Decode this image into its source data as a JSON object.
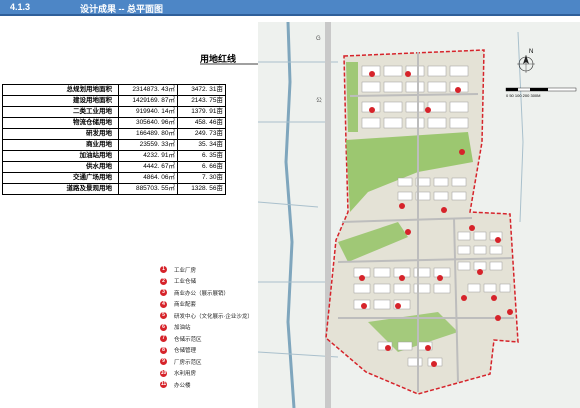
{
  "header": {
    "section": "4.1.3",
    "title": "设计成果 -- 总平面图"
  },
  "callout": "用地红线",
  "stats_table": [
    {
      "label": "总规划用地面积",
      "area": "2314873. 43㎡",
      "mu": "3472. 31亩"
    },
    {
      "label": "建设用地面积",
      "area": "1429169. 87㎡",
      "mu": "2143. 75亩"
    },
    {
      "label": "二类工业用地",
      "area": "919940. 14㎡",
      "mu": "1379. 91亩"
    },
    {
      "label": "物流仓储用地",
      "area": "305640. 96㎡",
      "mu": "458. 46亩"
    },
    {
      "label": "研发用地",
      "area": "166489. 80㎡",
      "mu": "249. 73亩"
    },
    {
      "label": "商业用地",
      "area": "23559. 33㎡",
      "mu": "35. 34亩"
    },
    {
      "label": "加油站用地",
      "area": "4232. 91㎡",
      "mu": "6. 35亩"
    },
    {
      "label": "供水用地",
      "area": "4442. 67㎡",
      "mu": "6. 66亩"
    },
    {
      "label": "交通广场用地",
      "area": "4864. 06㎡",
      "mu": "7. 30亩"
    },
    {
      "label": "道路及景观用地",
      "area": "885703. 55㎡",
      "mu": "1328. 56亩"
    }
  ],
  "legend": [
    {
      "num": "1",
      "label": "工业厂房"
    },
    {
      "num": "2",
      "label": "工业仓储"
    },
    {
      "num": "3",
      "label": "商业办公（展示展销）"
    },
    {
      "num": "4",
      "label": "商业配套"
    },
    {
      "num": "5",
      "label": "研发中心（文化展示·企业沙龙）"
    },
    {
      "num": "6",
      "label": "加油站"
    },
    {
      "num": "7",
      "label": "仓储示范区"
    },
    {
      "num": "8",
      "label": "仓储管理"
    },
    {
      "num": "9",
      "label": "厂房示范区"
    },
    {
      "num": "10",
      "label": "水利用房"
    },
    {
      "num": "11",
      "label": "办公楼"
    }
  ],
  "map": {
    "north": "N",
    "scale": "0  50 100  200     300M",
    "road_label": "公 路"
  },
  "colors": {
    "header": "#4d86c6",
    "marker": "#d6232a",
    "green": "#8fc25e"
  }
}
